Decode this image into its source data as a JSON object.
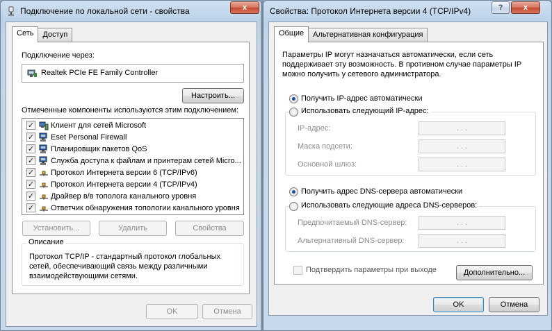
{
  "left_window": {
    "title": "Подключение по локальной сети - свойства",
    "close_label": "x",
    "tabs": [
      "Сеть",
      "Доступ"
    ],
    "connect_via_label": "Подключение через:",
    "adapter_name": "Realtek PCIe FE Family Controller",
    "configure_label": "Настроить...",
    "components_label": "Отмеченные компоненты используются этим подключением:",
    "components": [
      {
        "label": "Клиент для сетей Microsoft",
        "checked": true,
        "icon": "network-client-icon"
      },
      {
        "label": "Eset Personal Firewall",
        "checked": true,
        "icon": "network-service-icon"
      },
      {
        "label": "Планировщик пакетов QoS",
        "checked": true,
        "icon": "network-service-icon"
      },
      {
        "label": "Служба доступа к файлам и принтерам сетей Micro...",
        "checked": true,
        "icon": "network-service-icon"
      },
      {
        "label": "Протокол Интернета версии 6 (TCP/IPv6)",
        "checked": true,
        "icon": "protocol-icon"
      },
      {
        "label": "Протокол Интернета версии 4 (TCP/IPv4)",
        "checked": true,
        "icon": "protocol-icon"
      },
      {
        "label": "Драйвер в/в тополога канального уровня",
        "checked": true,
        "icon": "protocol-icon"
      },
      {
        "label": "Ответчик обнаружения топологии канального уровня",
        "checked": true,
        "icon": "protocol-icon"
      }
    ],
    "install_label": "Установить...",
    "remove_label": "Удалить",
    "properties_label": "Свойства",
    "description_title": "Описание",
    "description_text": "Протокол TCP/IP - стандартный протокол глобальных сетей, обеспечивающий связь между различными взаимодействующими сетями.",
    "ok_label": "OK",
    "cancel_label": "Отмена"
  },
  "right_window": {
    "title": "Свойства: Протокол Интернета версии 4 (TCP/IPv4)",
    "help_label": "?",
    "close_label": "x",
    "tabs": [
      "Общие",
      "Альтернативная конфигурация"
    ],
    "intro_text": "Параметры IP могут назначаться автоматически, если сеть поддерживает эту возможность. В противном случае параметры IP можно получить у сетевого администратора.",
    "ip_auto_label": "Получить IP-адрес автоматически",
    "ip_manual_label": "Использовать следующий IP-адрес:",
    "ip_fields": [
      {
        "label": "IP-адрес:"
      },
      {
        "label": "Маска подсети:"
      },
      {
        "label": "Основной шлюз:"
      }
    ],
    "dns_auto_label": "Получить адрес DNS-сервера автоматически",
    "dns_manual_label": "Использовать следующие адреса DNS-серверов:",
    "dns_fields": [
      {
        "label": "Предпочитаемый DNS-сервер:"
      },
      {
        "label": "Альтернативный DNS-сервер:"
      }
    ],
    "ip_dots": ".      .      .",
    "validate_label": "Подтвердить параметры при выходе",
    "advanced_label": "Дополнительно...",
    "ok_label": "OK",
    "cancel_label": "Отмена",
    "ip_auto_selected": true,
    "dns_auto_selected": true
  }
}
